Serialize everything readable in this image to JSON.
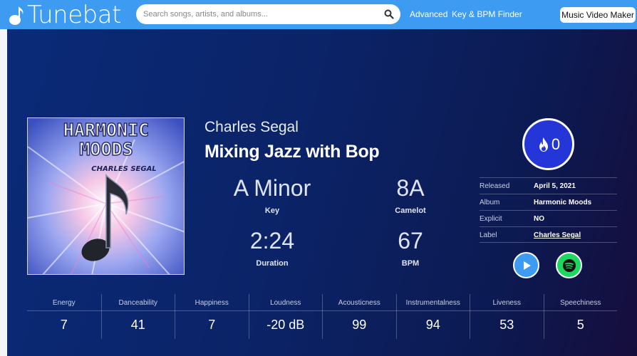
{
  "header": {
    "logo_text": "Tunebat",
    "search_placeholder": "Search songs, artists, and albums...",
    "nav_links": [
      "Advanced",
      "Key & BPM Finder"
    ],
    "music_video_button": "Music Video Maker",
    "accent_color": "#3d9bf2"
  },
  "track": {
    "artist": "Charles Segal",
    "title": "Mixing Jazz with Bop",
    "album_art_title_line1": "HARMONIC",
    "album_art_title_line2": "MOODS",
    "album_art_artist": "CHARLES SEGAL"
  },
  "stats": {
    "key": {
      "value": "A Minor",
      "label": "Key"
    },
    "camelot": {
      "value": "8A",
      "label": "Camelot"
    },
    "duration": {
      "value": "2:24",
      "label": "Duration"
    },
    "bpm": {
      "value": "67",
      "label": "BPM"
    }
  },
  "popularity": {
    "value": "0",
    "icon": "fire-icon"
  },
  "details": [
    {
      "key": "Released",
      "value": "April 5, 2021"
    },
    {
      "key": "Album",
      "value": "Harmonic Moods"
    },
    {
      "key": "Explicit",
      "value": "NO"
    },
    {
      "key": "Label",
      "value": "Charles Segal"
    }
  ],
  "metrics": [
    {
      "label": "Energy",
      "value": "7"
    },
    {
      "label": "Danceability",
      "value": "41"
    },
    {
      "label": "Happiness",
      "value": "7"
    },
    {
      "label": "Loudness",
      "value": "-20 dB"
    },
    {
      "label": "Acousticness",
      "value": "99"
    },
    {
      "label": "Instrumentalness",
      "value": "94"
    },
    {
      "label": "Liveness",
      "value": "53"
    },
    {
      "label": "Speechiness",
      "value": "5"
    }
  ],
  "colors": {
    "hero_background": "#0b2367",
    "popularity_circle": "#2436d8",
    "play_button": "#3d9bf2",
    "spotify_button": "#1ed760"
  }
}
